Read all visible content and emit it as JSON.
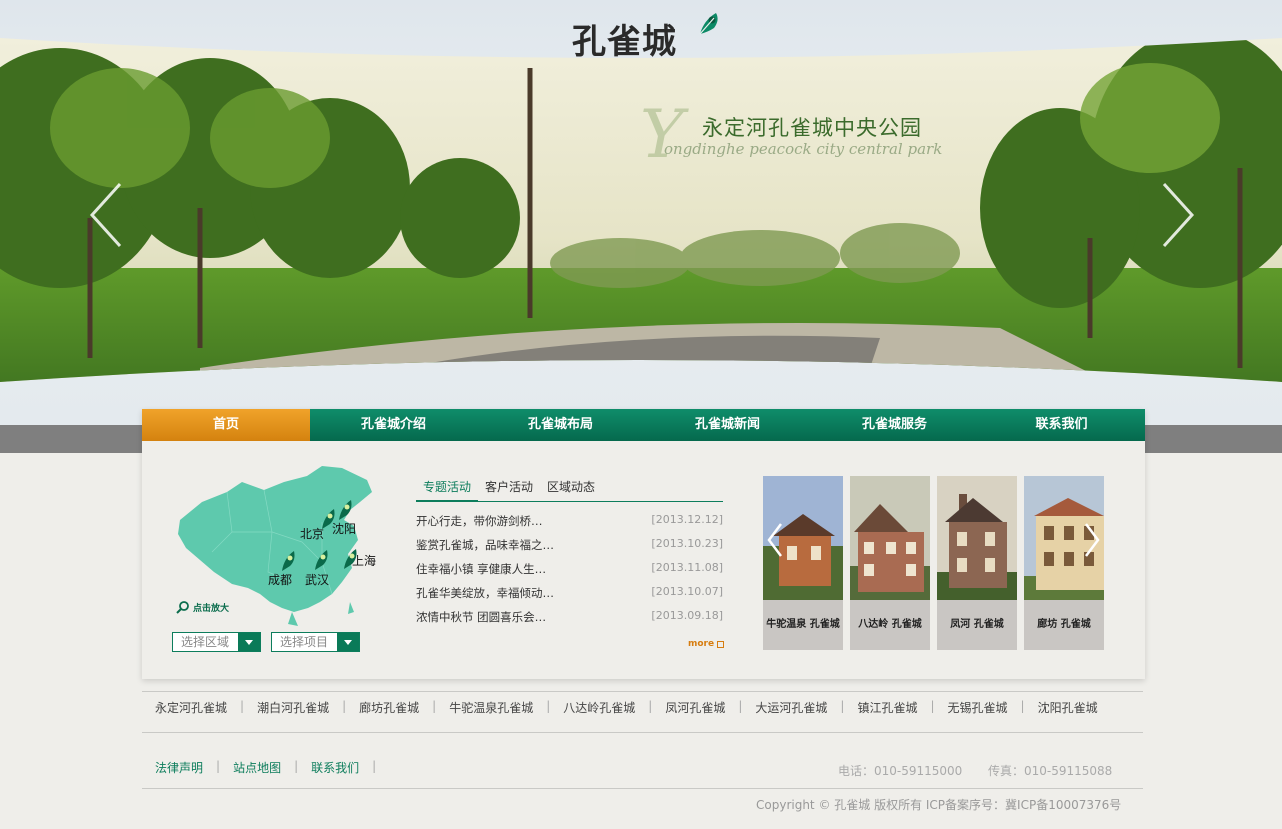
{
  "logo": {
    "text": "孔雀城"
  },
  "banner": {
    "title": "永定河孔雀城中央公园",
    "subtitle": "ongdinghe peacock city central park",
    "initial": "Y"
  },
  "nav": [
    {
      "label": "首页",
      "active": true
    },
    {
      "label": "孔雀城介绍"
    },
    {
      "label": "孔雀城布局"
    },
    {
      "label": "孔雀城新闻"
    },
    {
      "label": "孔雀城服务"
    },
    {
      "label": "联系我们"
    }
  ],
  "map": {
    "cities": [
      "北京",
      "沈阳",
      "上海",
      "成都",
      "武汉"
    ],
    "zoom_label": "点击放大",
    "select_region": "选择区域",
    "select_project": "选择项目",
    "map_color": "#5ec9ad"
  },
  "news": {
    "tabs": [
      "专题活动",
      "客户活动",
      "区域动态"
    ],
    "items": [
      {
        "title": "开心行走，带你游剑桥…",
        "date": "[2013.12.12]"
      },
      {
        "title": "鉴赏孔雀城，品味幸福之…",
        "date": "[2013.10.23]"
      },
      {
        "title": "住幸福小镇  享健康人生…",
        "date": "[2013.11.08]"
      },
      {
        "title": "孔雀华美绽放，幸福倾动…",
        "date": "[2013.10.07]"
      },
      {
        "title": "浓情中秋节  团圆喜乐会…",
        "date": "[2013.09.18]"
      }
    ],
    "more": "more"
  },
  "projects": [
    {
      "name": "牛驼温泉 孔雀城"
    },
    {
      "name": "八达岭 孔雀城"
    },
    {
      "name": "凤河 孔雀城"
    },
    {
      "name": "廊坊 孔雀城"
    }
  ],
  "project_links": [
    "永定河孔雀城",
    "潮白河孔雀城",
    "廊坊孔雀城",
    "牛驼温泉孔雀城",
    "八达岭孔雀城",
    "凤河孔雀城",
    "大运河孔雀城",
    "镇江孔雀城",
    "无锡孔雀城",
    "沈阳孔雀城"
  ],
  "footer": {
    "links": [
      "法律声明",
      "站点地图",
      "联系我们"
    ],
    "phone": "电话：010-59115000",
    "fax": "传真：010-59115088",
    "copyright": "Copyright © 孔雀城 版权所有 ICP备案序号：冀ICP备10007376号"
  },
  "colors": {
    "accent": "#0d7d5c",
    "active_nav": "#e8961d"
  }
}
